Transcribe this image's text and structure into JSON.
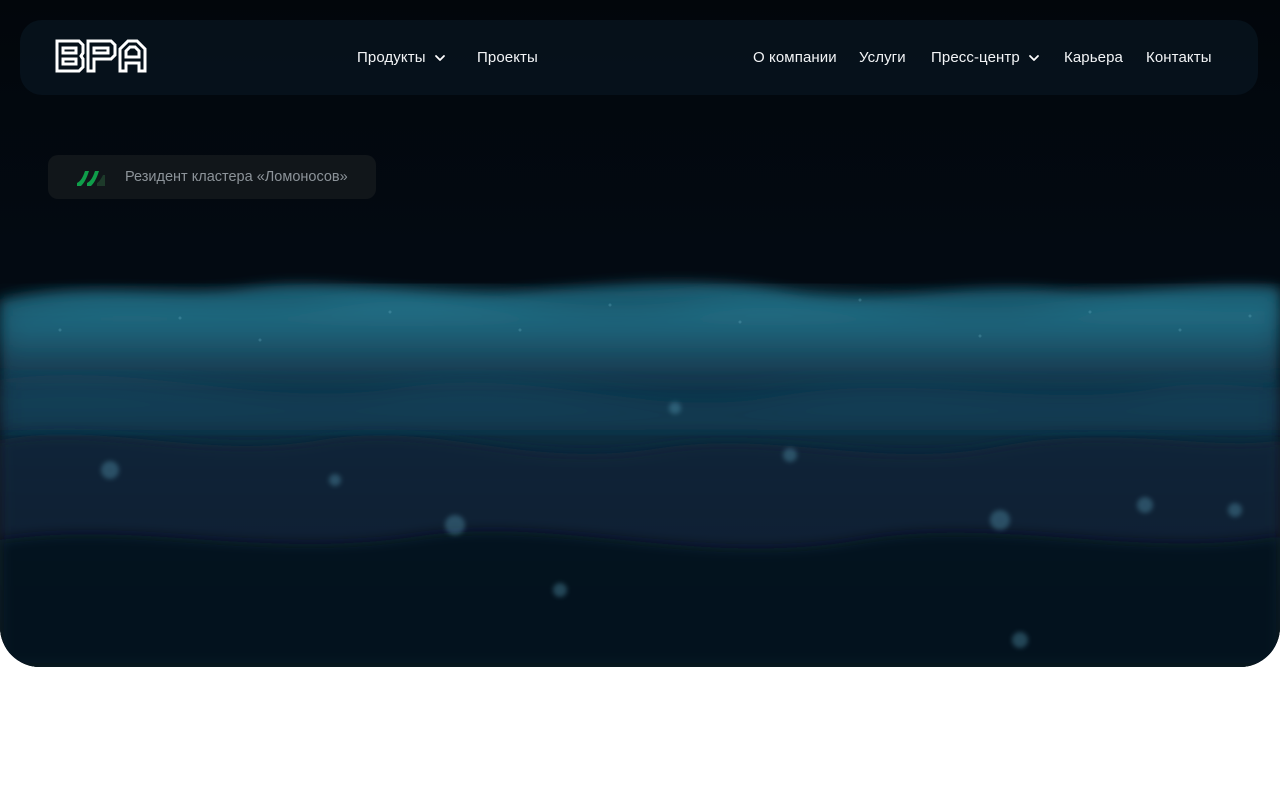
{
  "brand": {
    "logo_text": "BPA",
    "accent_color": "#0f9d4a"
  },
  "nav": {
    "left_items": [
      {
        "label": "Продукты",
        "has_dropdown": true
      },
      {
        "label": "Проекты",
        "has_dropdown": false
      }
    ],
    "right_items": [
      {
        "label": "О компании",
        "has_dropdown": false
      },
      {
        "label": "Услуги",
        "has_dropdown": false
      },
      {
        "label": "Пресс-центр",
        "has_dropdown": true
      },
      {
        "label": "Карьера",
        "has_dropdown": false
      },
      {
        "label": "Контакты",
        "has_dropdown": false
      }
    ]
  },
  "badge": {
    "icon": "lomonosov-cluster-logo",
    "text": "Резидент кластера «Ломоносов»"
  },
  "hero": {
    "background": "particle-wave",
    "colors": {
      "base": "#02060b",
      "wave_teal": "#1f6f86",
      "wave_blue": "#16354f"
    }
  }
}
